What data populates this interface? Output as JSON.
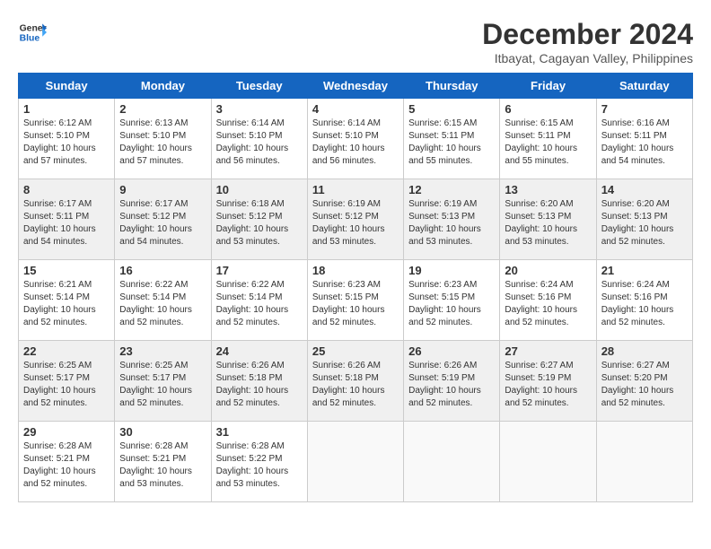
{
  "logo": {
    "line1": "General",
    "line2": "Blue"
  },
  "title": "December 2024",
  "subtitle": "Itbayat, Cagayan Valley, Philippines",
  "headers": [
    "Sunday",
    "Monday",
    "Tuesday",
    "Wednesday",
    "Thursday",
    "Friday",
    "Saturday"
  ],
  "weeks": [
    [
      {
        "day": "1",
        "sunrise": "6:12 AM",
        "sunset": "5:10 PM",
        "daylight": "10 hours and 57 minutes."
      },
      {
        "day": "2",
        "sunrise": "6:13 AM",
        "sunset": "5:10 PM",
        "daylight": "10 hours and 57 minutes."
      },
      {
        "day": "3",
        "sunrise": "6:14 AM",
        "sunset": "5:10 PM",
        "daylight": "10 hours and 56 minutes."
      },
      {
        "day": "4",
        "sunrise": "6:14 AM",
        "sunset": "5:10 PM",
        "daylight": "10 hours and 56 minutes."
      },
      {
        "day": "5",
        "sunrise": "6:15 AM",
        "sunset": "5:11 PM",
        "daylight": "10 hours and 55 minutes."
      },
      {
        "day": "6",
        "sunrise": "6:15 AM",
        "sunset": "5:11 PM",
        "daylight": "10 hours and 55 minutes."
      },
      {
        "day": "7",
        "sunrise": "6:16 AM",
        "sunset": "5:11 PM",
        "daylight": "10 hours and 54 minutes."
      }
    ],
    [
      {
        "day": "8",
        "sunrise": "6:17 AM",
        "sunset": "5:11 PM",
        "daylight": "10 hours and 54 minutes."
      },
      {
        "day": "9",
        "sunrise": "6:17 AM",
        "sunset": "5:12 PM",
        "daylight": "10 hours and 54 minutes."
      },
      {
        "day": "10",
        "sunrise": "6:18 AM",
        "sunset": "5:12 PM",
        "daylight": "10 hours and 53 minutes."
      },
      {
        "day": "11",
        "sunrise": "6:19 AM",
        "sunset": "5:12 PM",
        "daylight": "10 hours and 53 minutes."
      },
      {
        "day": "12",
        "sunrise": "6:19 AM",
        "sunset": "5:13 PM",
        "daylight": "10 hours and 53 minutes."
      },
      {
        "day": "13",
        "sunrise": "6:20 AM",
        "sunset": "5:13 PM",
        "daylight": "10 hours and 53 minutes."
      },
      {
        "day": "14",
        "sunrise": "6:20 AM",
        "sunset": "5:13 PM",
        "daylight": "10 hours and 52 minutes."
      }
    ],
    [
      {
        "day": "15",
        "sunrise": "6:21 AM",
        "sunset": "5:14 PM",
        "daylight": "10 hours and 52 minutes."
      },
      {
        "day": "16",
        "sunrise": "6:22 AM",
        "sunset": "5:14 PM",
        "daylight": "10 hours and 52 minutes."
      },
      {
        "day": "17",
        "sunrise": "6:22 AM",
        "sunset": "5:14 PM",
        "daylight": "10 hours and 52 minutes."
      },
      {
        "day": "18",
        "sunrise": "6:23 AM",
        "sunset": "5:15 PM",
        "daylight": "10 hours and 52 minutes."
      },
      {
        "day": "19",
        "sunrise": "6:23 AM",
        "sunset": "5:15 PM",
        "daylight": "10 hours and 52 minutes."
      },
      {
        "day": "20",
        "sunrise": "6:24 AM",
        "sunset": "5:16 PM",
        "daylight": "10 hours and 52 minutes."
      },
      {
        "day": "21",
        "sunrise": "6:24 AM",
        "sunset": "5:16 PM",
        "daylight": "10 hours and 52 minutes."
      }
    ],
    [
      {
        "day": "22",
        "sunrise": "6:25 AM",
        "sunset": "5:17 PM",
        "daylight": "10 hours and 52 minutes."
      },
      {
        "day": "23",
        "sunrise": "6:25 AM",
        "sunset": "5:17 PM",
        "daylight": "10 hours and 52 minutes."
      },
      {
        "day": "24",
        "sunrise": "6:26 AM",
        "sunset": "5:18 PM",
        "daylight": "10 hours and 52 minutes."
      },
      {
        "day": "25",
        "sunrise": "6:26 AM",
        "sunset": "5:18 PM",
        "daylight": "10 hours and 52 minutes."
      },
      {
        "day": "26",
        "sunrise": "6:26 AM",
        "sunset": "5:19 PM",
        "daylight": "10 hours and 52 minutes."
      },
      {
        "day": "27",
        "sunrise": "6:27 AM",
        "sunset": "5:19 PM",
        "daylight": "10 hours and 52 minutes."
      },
      {
        "day": "28",
        "sunrise": "6:27 AM",
        "sunset": "5:20 PM",
        "daylight": "10 hours and 52 minutes."
      }
    ],
    [
      {
        "day": "29",
        "sunrise": "6:28 AM",
        "sunset": "5:21 PM",
        "daylight": "10 hours and 52 minutes."
      },
      {
        "day": "30",
        "sunrise": "6:28 AM",
        "sunset": "5:21 PM",
        "daylight": "10 hours and 53 minutes."
      },
      {
        "day": "31",
        "sunrise": "6:28 AM",
        "sunset": "5:22 PM",
        "daylight": "10 hours and 53 minutes."
      },
      null,
      null,
      null,
      null
    ]
  ]
}
